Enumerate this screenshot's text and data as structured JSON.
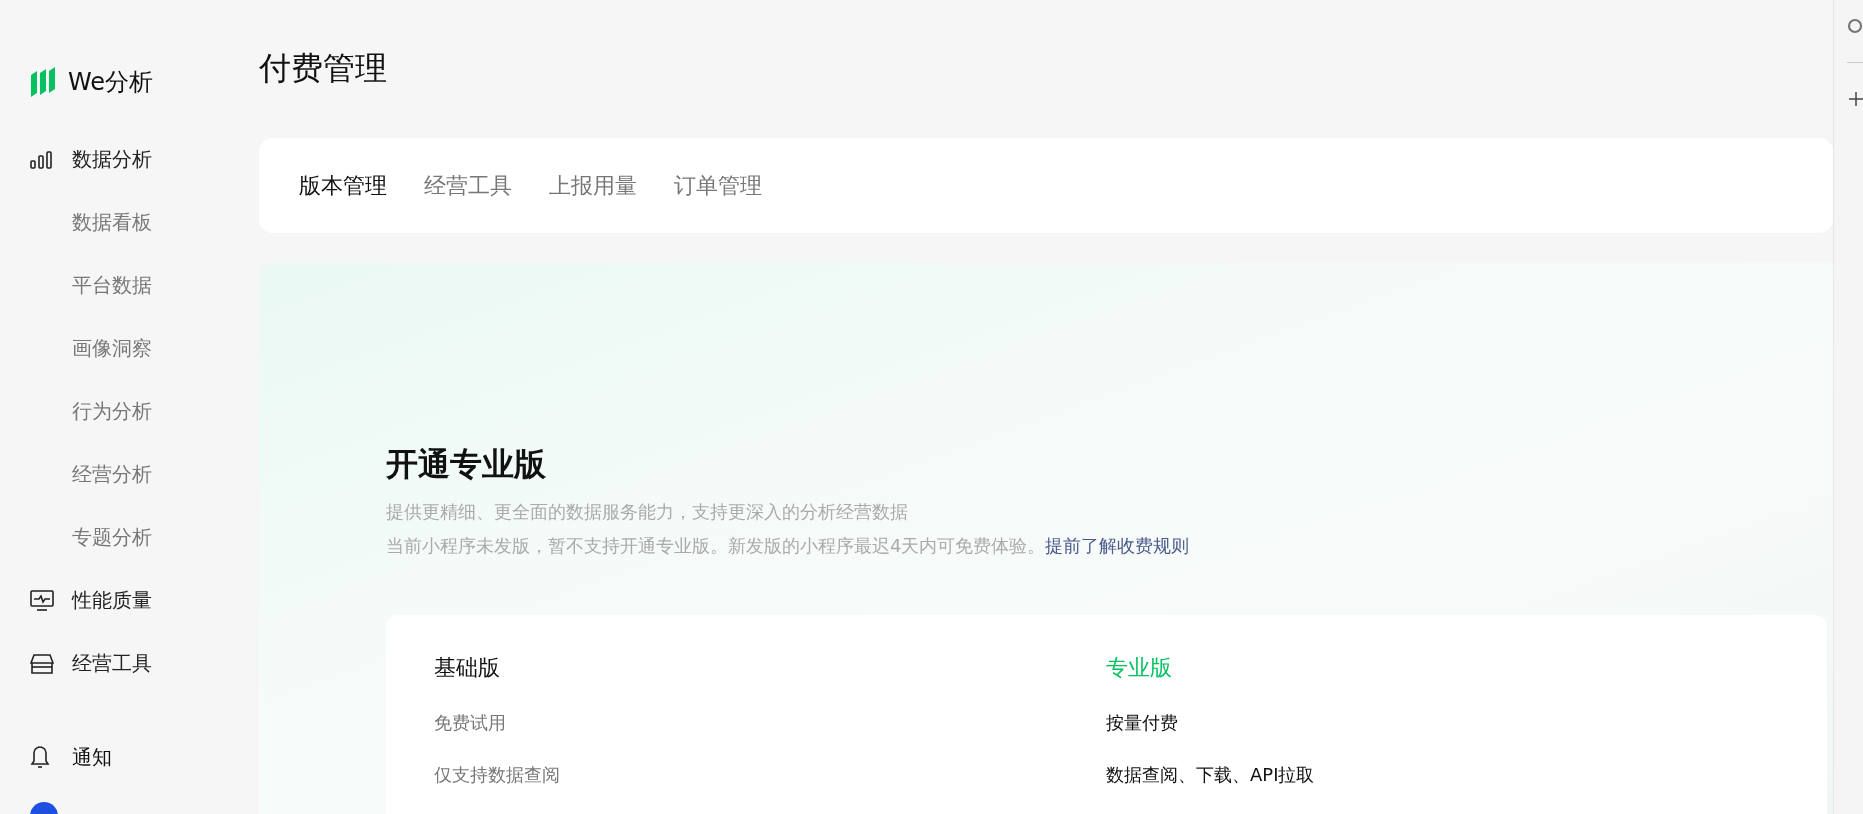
{
  "sidebar": {
    "logo": "We分析",
    "items": [
      {
        "label": "数据分析",
        "children": [
          {
            "label": "数据看板"
          },
          {
            "label": "平台数据"
          },
          {
            "label": "画像洞察"
          },
          {
            "label": "行为分析"
          },
          {
            "label": "经营分析"
          },
          {
            "label": "专题分析"
          }
        ]
      },
      {
        "label": "性能质量"
      },
      {
        "label": "经营工具"
      }
    ],
    "footer": {
      "label": "通知"
    }
  },
  "page": {
    "title": "付费管理",
    "tabs": [
      {
        "label": "版本管理",
        "selected": true
      },
      {
        "label": "经营工具",
        "selected": false
      },
      {
        "label": "上报用量",
        "selected": false
      },
      {
        "label": "订单管理",
        "selected": false
      }
    ],
    "hero": {
      "title": "开通专业版",
      "description": "提供更精细、更全面的数据服务能力，支持更深入的分析经营数据",
      "note": "当前小程序未发版，暂不支持开通专业版。新发版的小程序最迟4天内可免费体验。",
      "link": "提前了解收费规则"
    },
    "plans": [
      {
        "name": "基础版",
        "highlighted": false,
        "features": [
          "免费试用",
          "仅支持数据查阅"
        ]
      },
      {
        "name": "专业版",
        "highlighted": true,
        "features": [
          "按量付费",
          "数据查阅、下载、API拉取"
        ]
      }
    ]
  }
}
